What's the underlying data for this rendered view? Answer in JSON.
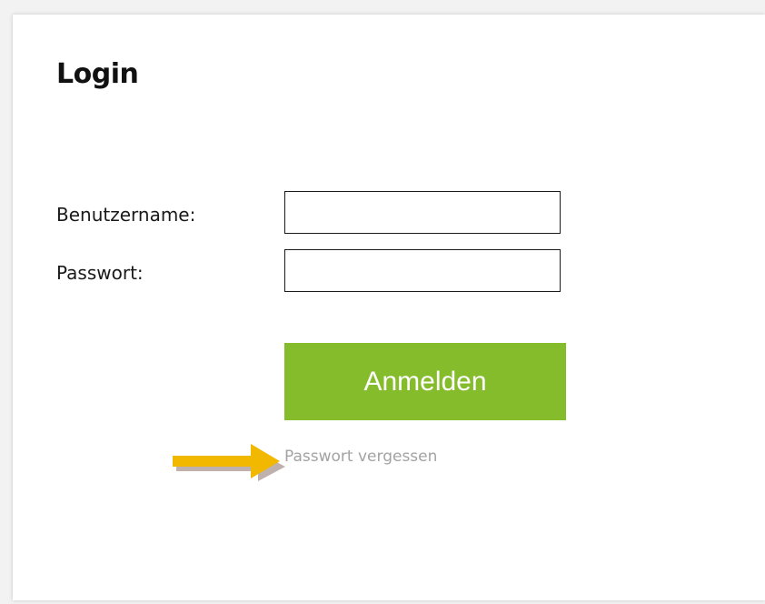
{
  "login": {
    "title": "Login",
    "username_label": "Benutzername:",
    "password_label": "Passwort:",
    "username_value": "",
    "password_value": "",
    "submit_label": "Anmelden",
    "forgot_password_label": "Passwort vergessen"
  },
  "colors": {
    "button_background": "#84bc2b",
    "button_text": "#ffffff",
    "link_text": "#a3a3a3",
    "arrow_annotation": "#f2b800"
  },
  "annotation": {
    "icon": "arrow-right-icon"
  }
}
